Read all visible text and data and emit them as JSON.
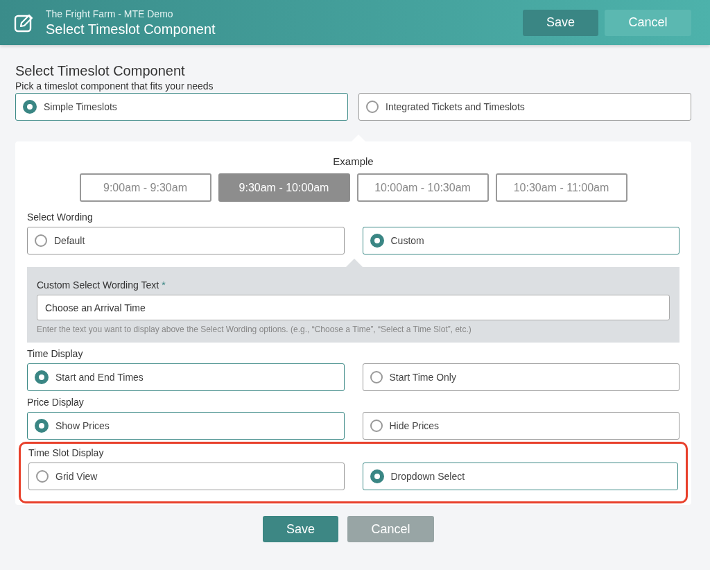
{
  "header": {
    "subtitle": "The Fright Farm - MTE Demo",
    "title": "Select Timeslot Component",
    "buttons": [
      {
        "label": "Save",
        "kind": "primary"
      },
      {
        "label": "Cancel",
        "kind": "secondary"
      }
    ]
  },
  "component": {
    "heading": "Select Timeslot Component",
    "description": "Pick a timeslot component that fits your needs",
    "options": [
      {
        "label": "Simple Timeslots",
        "selected": true
      },
      {
        "label": "Integrated Tickets and Timeslots",
        "selected": false
      }
    ]
  },
  "example": {
    "label": "Example",
    "slots": [
      {
        "label": "9:00am - 9:30am",
        "selected": false
      },
      {
        "label": "9:30am - 10:00am",
        "selected": true
      },
      {
        "label": "10:00am - 10:30am",
        "selected": false
      },
      {
        "label": "10:30am - 11:00am",
        "selected": false
      }
    ]
  },
  "sections": [
    {
      "label": "Select Wording",
      "highlighted": false,
      "options": [
        {
          "label": "Default",
          "selected": false
        },
        {
          "label": "Custom",
          "selected": true
        }
      ],
      "detail": {
        "label": "Custom Select Wording Text",
        "required_mark": "*",
        "value": "Choose an Arrival Time",
        "help": "Enter the text you want to display above the Select Wording options. (e.g., “Choose a Time”, “Select a Time Slot”, etc.)"
      }
    },
    {
      "label": "Time Display",
      "highlighted": false,
      "options": [
        {
          "label": "Start and End Times",
          "selected": true
        },
        {
          "label": "Start Time Only",
          "selected": false
        }
      ]
    },
    {
      "label": "Price Display",
      "highlighted": false,
      "options": [
        {
          "label": "Show Prices",
          "selected": true
        },
        {
          "label": "Hide Prices",
          "selected": false
        }
      ]
    },
    {
      "label": "Time Slot Display",
      "highlighted": true,
      "options": [
        {
          "label": "Grid View",
          "selected": false
        },
        {
          "label": "Dropdown Select",
          "selected": true
        }
      ]
    }
  ],
  "footer": {
    "buttons": [
      {
        "label": "Save",
        "kind": "primary"
      },
      {
        "label": "Cancel",
        "kind": "secondary"
      }
    ]
  }
}
